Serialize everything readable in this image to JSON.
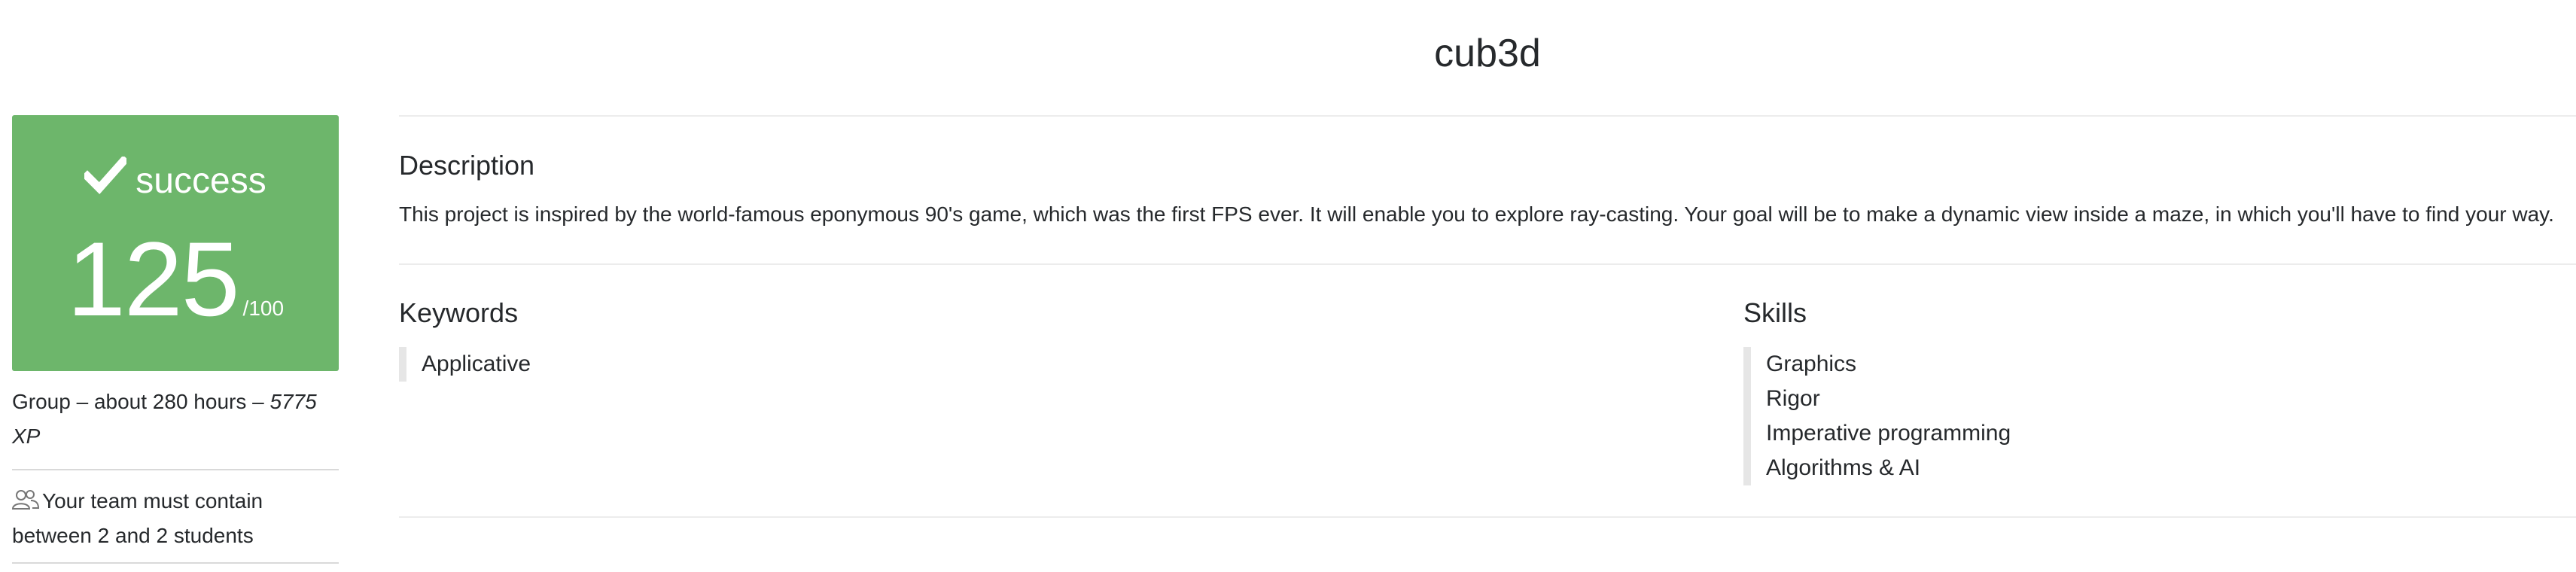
{
  "project": {
    "title": "cub3d"
  },
  "result": {
    "status": "success",
    "score": "125",
    "max_score": "/100",
    "color": "#6db66b",
    "status_icon": "check-icon"
  },
  "details": {
    "group_text": "Group – about 280 hours – ",
    "xp": "5775 XP",
    "team_icon": "users-icon",
    "team_text": "Your team must contain between 2 and 2 students"
  },
  "description": {
    "heading": "Description",
    "text": "This project is inspired by the world-famous eponymous 90's game, which was the first FPS ever. It will enable you to explore ray-casting. Your goal will be to make a dynamic view inside a maze, in which you'll have to find your way."
  },
  "keywords": {
    "heading": "Keywords",
    "items": [
      "Applicative"
    ]
  },
  "skills": {
    "heading": "Skills",
    "items": [
      "Graphics",
      "Rigor",
      "Imperative programming",
      "Algorithms & AI"
    ]
  }
}
